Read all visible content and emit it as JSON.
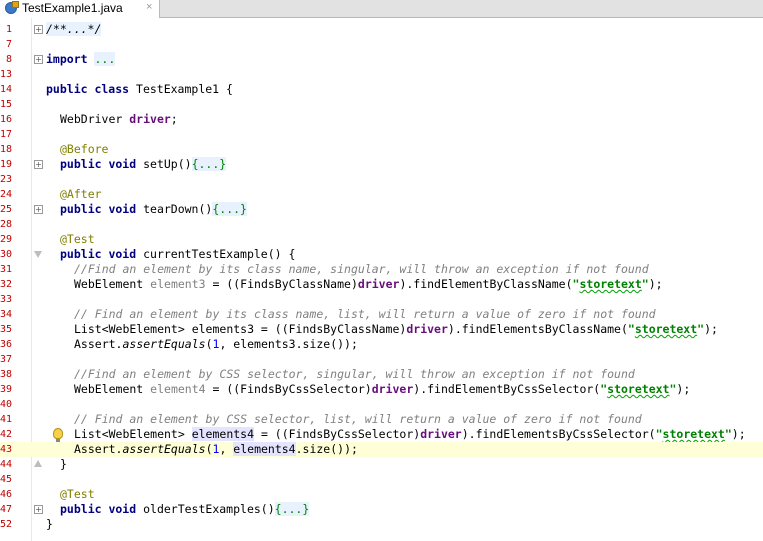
{
  "tab": {
    "title": "TestExample1.java",
    "close_symbol": "×",
    "icon": "java-class-icon"
  },
  "colors": {
    "keyword": "#000080",
    "annotation": "#808000",
    "comment": "#808080",
    "string": "#008000",
    "field": "#660e7a",
    "number": "#0000ff",
    "line_number": "#c00000",
    "current_line": "#ffffd7"
  },
  "lines": [
    {
      "num": "1",
      "text": "/**...*/"
    },
    {
      "num": "7",
      "text": ""
    },
    {
      "num": "8",
      "text": "import ..."
    },
    {
      "num": "13",
      "text": ""
    },
    {
      "num": "14",
      "text": "public class TestExample1 {"
    },
    {
      "num": "15",
      "text": ""
    },
    {
      "num": "16",
      "text": "WebDriver driver;"
    },
    {
      "num": "17",
      "text": ""
    },
    {
      "num": "18",
      "text": "@Before"
    },
    {
      "num": "19",
      "text": "public void setUp(){...}"
    },
    {
      "num": "23",
      "text": ""
    },
    {
      "num": "24",
      "text": "@After"
    },
    {
      "num": "25",
      "text": "public void tearDown(){...}"
    },
    {
      "num": "28",
      "text": ""
    },
    {
      "num": "29",
      "text": "@Test"
    },
    {
      "num": "30",
      "text": "public void currentTestExample() {"
    },
    {
      "num": "31",
      "text": "//Find an element by its class name, singular, will throw an exception if not found"
    },
    {
      "num": "32",
      "text": "WebElement element3 = ((FindsByClassName)driver).findElementByClassName(\"storetext\");"
    },
    {
      "num": "33",
      "text": ""
    },
    {
      "num": "34",
      "text": "// Find an element by its class name, list, will return a value of zero if not found"
    },
    {
      "num": "35",
      "text": "List<WebElement> elements3 = ((FindsByClassName)driver).findElementsByClassName(\"storetext\");"
    },
    {
      "num": "36",
      "text": "Assert.assertEquals(1, elements3.size());"
    },
    {
      "num": "37",
      "text": ""
    },
    {
      "num": "38",
      "text": "//Find an element by CSS selector, singular, will throw an exception if not found"
    },
    {
      "num": "39",
      "text": "WebElement element4 = ((FindsByCssSelector)driver).findElementByCssSelector(\"storetext\");"
    },
    {
      "num": "40",
      "text": ""
    },
    {
      "num": "41",
      "text": "// Find an element by CSS selector, list, will return a value of zero if not found"
    },
    {
      "num": "42",
      "text": "List<WebElement> elements4 = ((FindsByCssSelector)driver).findElementsByCssSelector(\"storetext\");"
    },
    {
      "num": "43",
      "text": "Assert.assertEquals(1, elements4.size());"
    },
    {
      "num": "44",
      "text": "}"
    },
    {
      "num": "45",
      "text": ""
    },
    {
      "num": "46",
      "text": "@Test"
    },
    {
      "num": "47",
      "text": "public void olderTestExamples(){...}"
    },
    {
      "num": "52",
      "text": "}"
    }
  ]
}
